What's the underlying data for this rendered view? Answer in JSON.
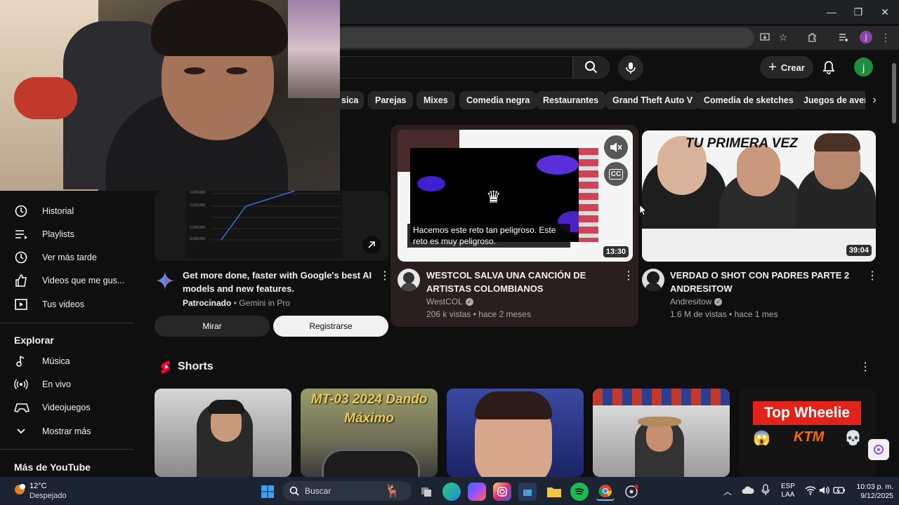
{
  "window": {
    "minimize": "—",
    "maximize": "❐",
    "close": "✕"
  },
  "toolbar_icons": [
    "install-icon",
    "star-icon",
    "extensions-icon",
    "media-icon",
    "profile-icon",
    "menu-icon"
  ],
  "profile_initial": "j",
  "header": {
    "create_label": "Crear",
    "avatar_initial": "j"
  },
  "chips": [
    "sica",
    "Parejas",
    "Mixes",
    "Comedia negra",
    "Restaurantes",
    "Grand Theft Auto V",
    "Comedia de sketches",
    "Juegos de avent"
  ],
  "sidebar": {
    "items": [
      {
        "label": "Historial",
        "icon": "history-icon"
      },
      {
        "label": "Playlists",
        "icon": "playlist-icon"
      },
      {
        "label": "Ver más tarde",
        "icon": "watch-later-icon"
      },
      {
        "label": "Videos que me gus...",
        "icon": "like-icon"
      },
      {
        "label": "Tus videos",
        "icon": "your-videos-icon"
      }
    ],
    "explore_title": "Explorar",
    "explore": [
      {
        "label": "Música",
        "icon": "music-icon"
      },
      {
        "label": "En vivo",
        "icon": "live-icon"
      },
      {
        "label": "Videojuegos",
        "icon": "gaming-icon"
      },
      {
        "label": "Mostrar más",
        "icon": "chevron-down-icon"
      }
    ],
    "more_title": "Más de YouTube"
  },
  "ad": {
    "title": "Get more done, faster with Google's best AI models and new features.",
    "sponsor": "Patrocinado",
    "advertiser": "Gemini in Pro",
    "watch_label": "Mirar",
    "register_label": "Registrarse",
    "chart_ticks": [
      "3,000,000",
      "2,000,000",
      "1,000,000",
      "0,000,000"
    ]
  },
  "video1": {
    "title": "WESTCOL SALVA UNA CANCIÓN DE ARTISTAS COLOMBIANOS",
    "channel": "WestCOL",
    "meta": "206 k vistas • hace 2 meses",
    "duration": "13:30",
    "caption": "Hacemos este reto tan peligroso. Este reto es muy peligroso.",
    "cc_label": "CC"
  },
  "video2": {
    "title": "VERDAD O SHOT CON PADRES PARTE 2 ANDRESITOW",
    "channel": "Andresitow",
    "meta": "1.6 M de vistas • hace 1 mes",
    "duration": "39:04",
    "banner": "TU PRIMERA VEZ"
  },
  "shorts": {
    "title": "Shorts",
    "items": [
      {
        "overlay": ""
      },
      {
        "overlay": "MT-03 2024 Dando Máximo"
      },
      {
        "overlay": ""
      },
      {
        "overlay": ""
      },
      {
        "overlay": "Top Wheelie KTM"
      }
    ]
  },
  "taskbar": {
    "temp": "12°C",
    "weather": "Despejado",
    "search": "Buscar",
    "lang1": "ESP",
    "lang2": "LAA",
    "time": "10:03 p. m.",
    "date": "9/12/2025"
  },
  "colors": {
    "bg": "#0f0f0f",
    "red": "#ff0000",
    "verified": "#aaaaaa"
  }
}
